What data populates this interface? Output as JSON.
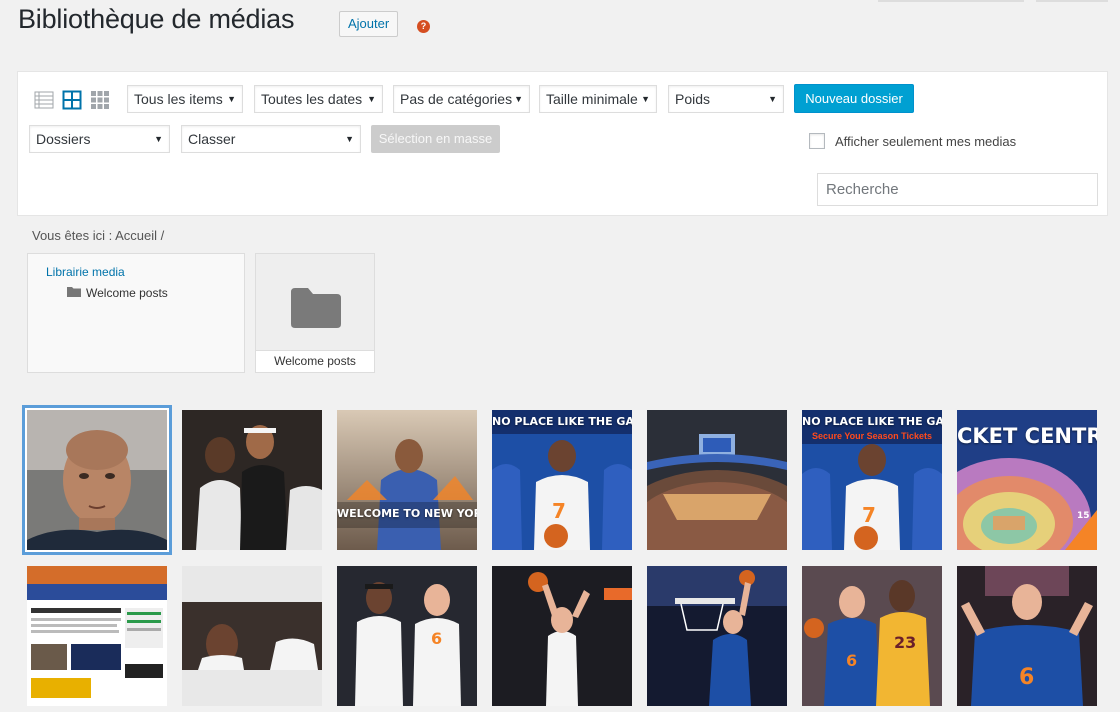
{
  "header": {
    "title": "Bibliothèque de médias",
    "add_label": "Ajouter",
    "help_symbol": "?"
  },
  "toolbar": {
    "filters": [
      "Tous les items",
      "Toutes les dates",
      "Pas de catégories",
      "Taille minimale",
      "Poids"
    ],
    "new_folder_label": "Nouveau dossier",
    "folders_select": "Dossiers",
    "sort_select": "Classer",
    "bulk_select_label": "Sélection en masse",
    "only_my_media_label": "Afficher seulement mes medias",
    "only_my_media_checked": false,
    "search_placeholder": "Recherche"
  },
  "breadcrumb": {
    "text": "Vous êtes ici :",
    "home": "Accueil",
    "separator": "/"
  },
  "folder_tree": {
    "root": "Librairie media",
    "children": [
      "Welcome posts"
    ]
  },
  "folder_tiles": [
    {
      "label": "Welcome posts"
    }
  ],
  "thumbnails": {
    "t3_caption": "WELCOME TO NEW YORK",
    "t4_caption": "NO PLACE LIKE THE GARDEN",
    "t6_caption": "NO PLACE LIKE THE GARDEN",
    "t6_subcaption": "Secure Your Season Tickets",
    "t7_caption": "CKET CENTRA",
    "t7_number": "15",
    "jersey_numbers": [
      "7",
      "6",
      "23"
    ]
  },
  "colors": {
    "primary": "#00a0d2",
    "link": "#0073aa",
    "selection": "#5b9dd9",
    "knicks_blue": "#1d4fa6",
    "knicks_orange": "#f58426",
    "help": "#d54e21"
  }
}
